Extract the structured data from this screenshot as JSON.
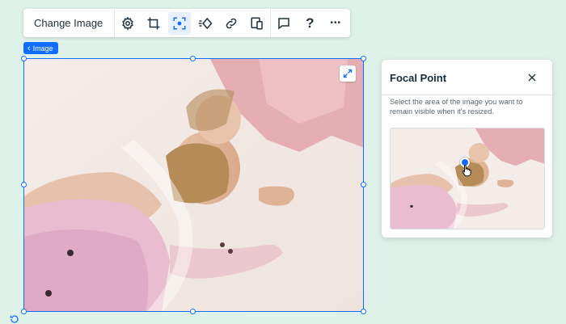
{
  "toolbar": {
    "change_image_label": "Change Image",
    "icons": [
      "gear-icon",
      "crop-icon",
      "focal-point-icon",
      "animation-icon",
      "link-icon",
      "responsive-icon",
      "comment-icon",
      "help-icon",
      "more-icon"
    ],
    "help_glyph": "?",
    "more_glyph": "•••",
    "active_icon": "focal-point-icon"
  },
  "image_tag": {
    "label": "Image",
    "chevron": "‹"
  },
  "panel": {
    "title": "Focal Point",
    "description": "Select the area of the image you want to remain visible when it's resized."
  },
  "colors": {
    "accent": "#116dff",
    "canvas_bg": "#dff2e9",
    "jacket_pink": "#e8b8bd",
    "floor": "#f6efec"
  }
}
